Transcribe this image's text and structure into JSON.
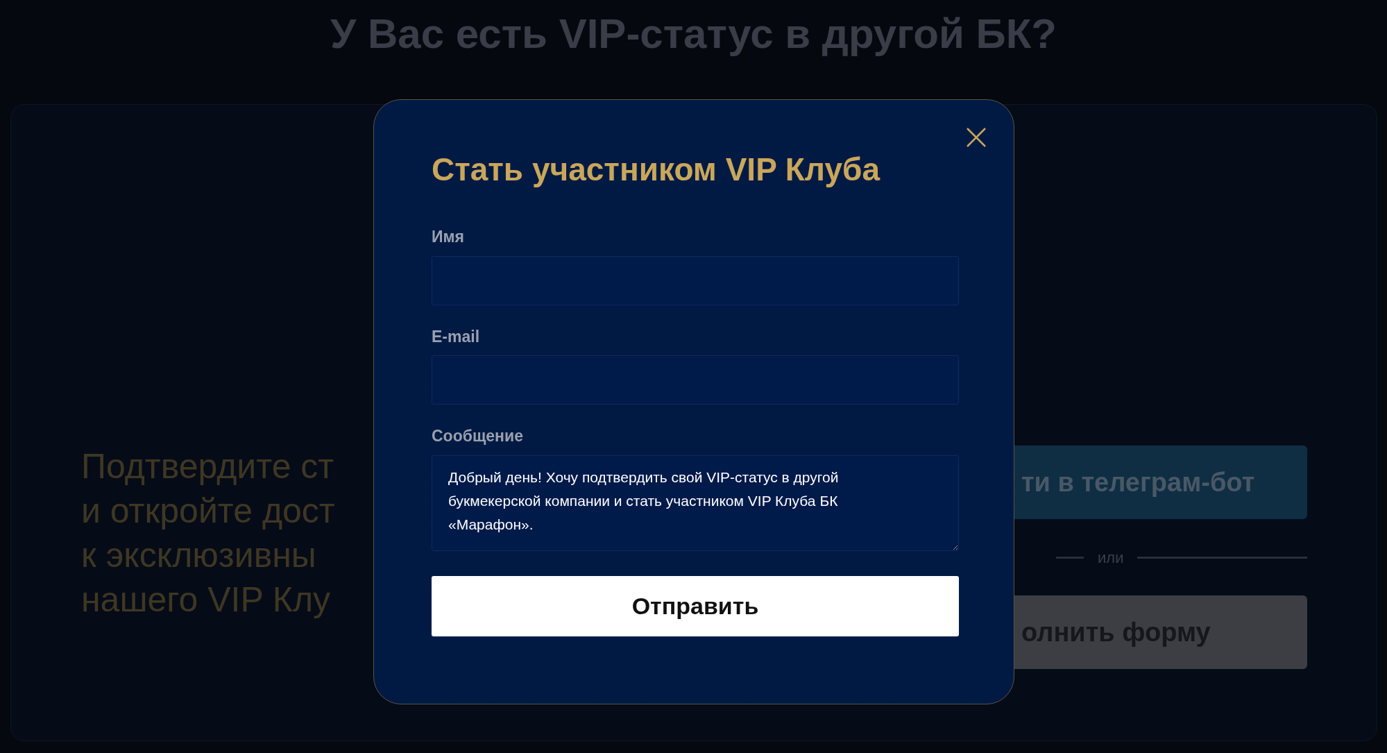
{
  "page": {
    "heading": "У Вас есть VIP-статус в другой БК?",
    "left_text_lines": [
      "Подтвердите ст",
      "и откройте дост",
      "к эксклюзивны",
      "нашего VIP Клу"
    ],
    "telegram_button": "ти в телеграм-бот",
    "divider_text": "или",
    "form_button": "олнить форму"
  },
  "modal": {
    "title": "Стать участником VIP Клуба",
    "fields": [
      {
        "kind": "input",
        "label": "Имя"
      },
      {
        "kind": "input",
        "label": "E-mail"
      },
      {
        "kind": "textarea",
        "label": "Сообщение",
        "value": "Добрый день! Хочу подтвердить свой VIP-статус в другой букмекерской компании и стать участником VIP Клуба БК «Марафон»."
      }
    ],
    "submit": "Отправить"
  }
}
